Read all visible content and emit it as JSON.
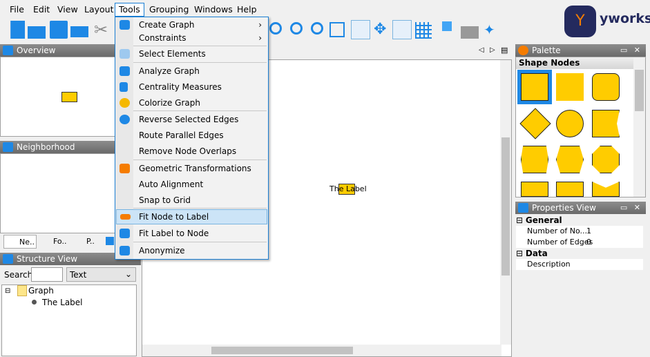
{
  "menubar": {
    "items": [
      "File",
      "Edit",
      "View",
      "Layout",
      "Tools",
      "Grouping",
      "Windows",
      "Help"
    ],
    "active": "Tools"
  },
  "toolbar": {
    "icons": [
      "new-document-icon",
      "open-icon",
      "save-icon",
      "print-icon",
      "cut-icon",
      "zoom-original-icon",
      "zoom-in-icon",
      "zoom-out-icon",
      "fit-content-icon",
      "edit-mode-icon",
      "move-icon",
      "orthogonal-edge-icon",
      "grid-icon",
      "label-edit-icon",
      "export-icon",
      "magic-wand-icon"
    ]
  },
  "brand": {
    "name": "yworks",
    "color": "#242a5e",
    "accent": "#f57c00"
  },
  "tools_menu": {
    "items": [
      {
        "label": "Create Graph",
        "submenu": true
      },
      {
        "label": "Constraints",
        "submenu": true
      },
      {
        "label": "Select Elements"
      },
      {
        "label": "Analyze Graph"
      },
      {
        "label": "Centrality Measures"
      },
      {
        "label": "Colorize Graph"
      },
      {
        "label": "Reverse Selected Edges"
      },
      {
        "label": "Route Parallel Edges"
      },
      {
        "label": "Remove Node Overlaps"
      },
      {
        "label": "Geometric Transformations"
      },
      {
        "label": "Auto Alignment"
      },
      {
        "label": "Snap to Grid"
      },
      {
        "label": "Fit Node to Label",
        "highlighted": true
      },
      {
        "label": "Fit Label to Node"
      },
      {
        "label": "Anonymize"
      }
    ]
  },
  "overview": {
    "title": "Overview"
  },
  "neighborhood": {
    "title": "Neighborhood",
    "tabs": [
      "Ne..",
      "Fo..",
      "P..",
      ""
    ]
  },
  "structure": {
    "title": "Structure View",
    "search_label": "Search",
    "search_value": "",
    "filter": "Text",
    "tree": {
      "root": "Graph",
      "children": [
        "The Label"
      ]
    }
  },
  "canvas": {
    "node_label": "The Label",
    "node_color": "#ffcc00"
  },
  "palette": {
    "title": "Palette",
    "section": "Shape Nodes"
  },
  "properties": {
    "title": "Properties View",
    "groups": [
      {
        "name": "General",
        "rows": [
          {
            "key": "Number of No...",
            "value": "1"
          },
          {
            "key": "Number of Edges",
            "value": "0"
          }
        ]
      },
      {
        "name": "Data",
        "rows": [
          {
            "key": "Description",
            "value": ""
          }
        ]
      }
    ]
  }
}
